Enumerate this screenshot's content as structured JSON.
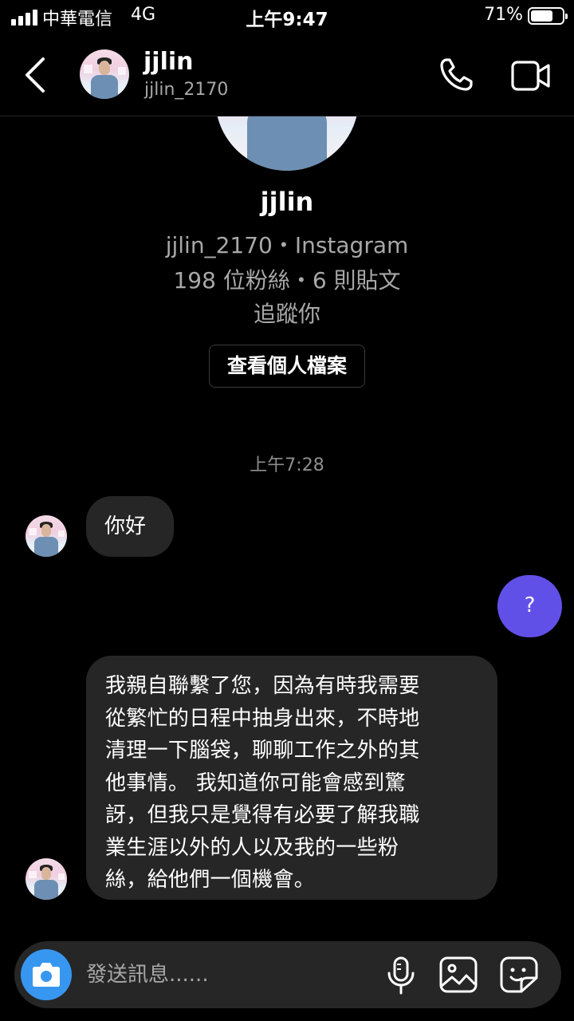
{
  "status_bar": {
    "carrier": "中華電信",
    "network": "4G",
    "time": "上午9:47",
    "battery_percent": "71%",
    "battery_level": 0.71
  },
  "header": {
    "back_icon": "chevron-left-icon",
    "display_name": "jjlin",
    "username": "jjlin_2170",
    "call_icon": "phone-icon",
    "video_icon": "video-camera-icon"
  },
  "profile": {
    "name": "jjlin",
    "meta": "jjlin_2170・Instagram",
    "stats": "198 位粉絲・6 則貼文",
    "follow_status": "追蹤你",
    "view_profile_label": "查看個人檔案"
  },
  "messages": {
    "timestamp": "上午7:28",
    "items": [
      {
        "from": "other",
        "text": "你好"
      },
      {
        "from": "me",
        "text": "?"
      },
      {
        "from": "other",
        "text": "我親自聯繫了您，因為有時我需要\n從繁忙的日程中抽身出來，不時地\n清理一下腦袋，聊聊工作之外的其\n他事情。 我知道你可能會感到驚\n訝，但我只是覺得有必要了解我職\n業生涯以外的人以及我的一些粉\n絲，給他們一個機會。"
      }
    ]
  },
  "composer": {
    "placeholder": "發送訊息......",
    "camera_icon": "camera-icon",
    "mic_icon": "microphone-icon",
    "gallery_icon": "image-icon",
    "sticker_icon": "sticker-icon"
  },
  "colors": {
    "background": "#000000",
    "incoming_bubble": "#262626",
    "outgoing_bubble": "#6150e8",
    "camera_button": "#3797f0",
    "secondary_text": "#a8a8a8"
  }
}
